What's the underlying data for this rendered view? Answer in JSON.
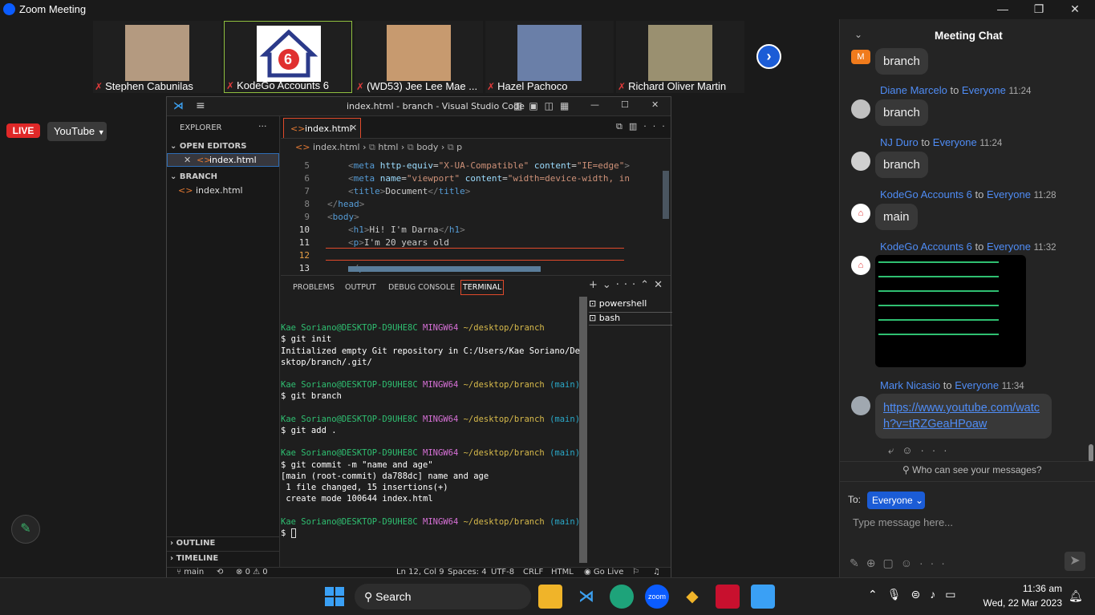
{
  "window": {
    "title": "Zoom Meeting"
  },
  "participants": [
    {
      "name": "Stephen Cabunilas"
    },
    {
      "name": "KodeGo Accounts 6"
    },
    {
      "name": "(WD53) Jee Lee Mae ..."
    },
    {
      "name": "Hazel Pachoco"
    },
    {
      "name": "Richard Oliver Martin"
    }
  ],
  "live": {
    "badge": "LIVE",
    "platform": "YouTube"
  },
  "vscode": {
    "title": "index.html - branch - Visual Studio Code",
    "explorer": "EXPLORER",
    "open_editors": "OPEN EDITORS",
    "open_file": "index.html",
    "folder": "BRANCH",
    "folder_file": "index.html",
    "outline": "OUTLINE",
    "timeline": "TIMELINE",
    "tab": "index.html",
    "breadcrumb": {
      "file": "index.html",
      "html": "html",
      "body": "body",
      "p": "p"
    },
    "lines": [
      "5",
      "6",
      "7",
      "8",
      "9",
      "10",
      "11",
      "12",
      "13"
    ],
    "panel_tabs": [
      "PROBLEMS",
      "OUTPUT",
      "DEBUG CONSOLE",
      "TERMINAL"
    ],
    "shells": [
      "powershell",
      "bash"
    ],
    "term": {
      "user": "Kae Soriano@DESKTOP-D9UHE8C",
      "mingw": "MINGW64",
      "path": "~/desktop/branch",
      "branch": "(main)",
      "cmd1": "$ git init",
      "out1a": "Initialized empty Git repository in C:/Users/Kae Soriano/De",
      "out1b": "sktop/branch/.git/",
      "cmd2": "$ git branch",
      "cmd3": "$ git add .",
      "cmd4": "$ git commit -m \"name and age\"",
      "out4a": "[main (root-commit) da788dc] name and age",
      "out4b": " 1 file changed, 15 insertions(+)",
      "out4c": " create mode 100644 index.html",
      "prompt": "$ "
    },
    "status": {
      "branch": "main",
      "errors": "0",
      "warnings": "0",
      "pos": "Ln 12, Col 9",
      "spaces": "Spaces: 4",
      "enc": "UTF-8",
      "eol": "CRLF",
      "lang": "HTML",
      "golive": "Go Live"
    }
  },
  "chat": {
    "header": "Meeting Chat",
    "to_word": "to",
    "messages": [
      {
        "sender": "",
        "to": "",
        "time": "",
        "text": "branch"
      },
      {
        "sender": "Diane Marcelo",
        "to": "Everyone",
        "time": "11:24",
        "text": "branch"
      },
      {
        "sender": "NJ Duro",
        "to": "Everyone",
        "time": "11:24",
        "text": "branch"
      },
      {
        "sender": "KodeGo Accounts 6",
        "to": "Everyone",
        "time": "11:28",
        "text": "main"
      },
      {
        "sender": "KodeGo Accounts 6",
        "to": "Everyone",
        "time": "11:32",
        "text": ""
      },
      {
        "sender": "Mark Nicasio",
        "to": "Everyone",
        "time": "11:34",
        "text": "https://www.youtube.com/watch?v=tRZGeaHPoaw"
      }
    ],
    "first_avatar": "M",
    "privacy": "Who can see your messages?",
    "to_label": "To:",
    "recipient": "Everyone",
    "placeholder": "Type message here..."
  },
  "taskbar": {
    "search": "Search",
    "time": "11:36 am",
    "date": "Wed, 22 Mar 2023"
  }
}
